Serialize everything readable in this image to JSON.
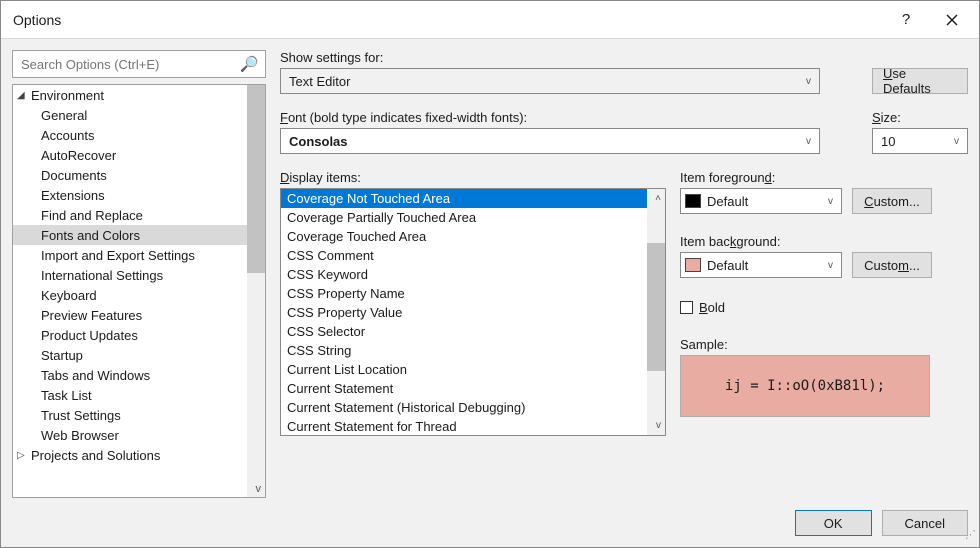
{
  "window": {
    "title": "Options"
  },
  "search": {
    "placeholder": "Search Options (Ctrl+E)"
  },
  "tree": {
    "top": [
      {
        "label": "Environment",
        "expanded": true,
        "children": [
          "General",
          "Accounts",
          "AutoRecover",
          "Documents",
          "Extensions",
          "Find and Replace",
          "Fonts and Colors",
          "Import and Export Settings",
          "International Settings",
          "Keyboard",
          "Preview Features",
          "Product Updates",
          "Startup",
          "Tabs and Windows",
          "Task List",
          "Trust Settings",
          "Web Browser"
        ],
        "selected_child": 6
      },
      {
        "label": "Projects and Solutions",
        "expanded": false
      }
    ]
  },
  "settings": {
    "show_settings_label": "Show settings for:",
    "show_settings_value": "Text Editor",
    "use_defaults": "Use Defaults",
    "font_label": "Font (bold type indicates fixed-width fonts):",
    "font_value": "Consolas",
    "size_label": "Size:",
    "size_value": "10",
    "display_items_label": "Display items:",
    "display_items": [
      "Coverage Not Touched Area",
      "Coverage Partially Touched Area",
      "Coverage Touched Area",
      "CSS Comment",
      "CSS Keyword",
      "CSS Property Name",
      "CSS Property Value",
      "CSS Selector",
      "CSS String",
      "Current List Location",
      "Current Statement",
      "Current Statement (Historical Debugging)",
      "Current Statement for Thread"
    ],
    "display_items_selected": 0,
    "item_fg_label": "Item foreground:",
    "item_fg_value": "Default",
    "item_fg_swatch": "#000000",
    "item_bg_label": "Item background:",
    "item_bg_value": "Default",
    "item_bg_swatch": "#e8aca3",
    "custom_label": "Custom...",
    "bold_label": "Bold",
    "sample_label": "Sample:",
    "sample_text": "ij = I::oO(0xB81l);"
  },
  "footer": {
    "ok": "OK",
    "cancel": "Cancel"
  }
}
